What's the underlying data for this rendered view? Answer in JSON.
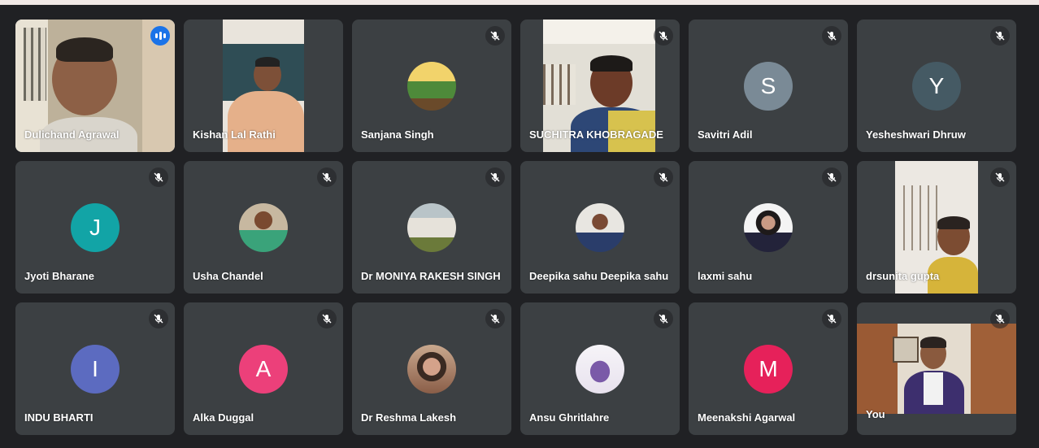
{
  "participants": [
    {
      "name": "Dulichand Agrawal",
      "type": "video",
      "speaking": true
    },
    {
      "name": "Kishan Lal Rathi",
      "type": "video"
    },
    {
      "name": "Sanjana Singh",
      "type": "photo",
      "muted": true
    },
    {
      "name": "SUCHITRA KHOBRAGADE",
      "type": "video",
      "muted": true
    },
    {
      "name": "Savitri Adil",
      "type": "initial",
      "initial": "S",
      "color": "#7a8a96",
      "muted": true
    },
    {
      "name": "Yesheshwari Dhruw",
      "type": "initial",
      "initial": "Y",
      "color": "#455a64",
      "muted": true
    },
    {
      "name": "Jyoti Bharane",
      "type": "initial",
      "initial": "J",
      "color": "#12a4a6",
      "muted": true
    },
    {
      "name": "Usha Chandel",
      "type": "photo",
      "muted": true
    },
    {
      "name": "Dr MONIYA RAKESH SINGH",
      "type": "photo",
      "muted": true
    },
    {
      "name": "Deepika sahu Deepika sahu",
      "type": "photo",
      "muted": true
    },
    {
      "name": "laxmi sahu",
      "type": "photo",
      "muted": true
    },
    {
      "name": "drsunita gupta",
      "type": "video",
      "muted": true
    },
    {
      "name": "INDU BHARTI",
      "type": "initial",
      "initial": "I",
      "color": "#5c6bc0",
      "muted": true
    },
    {
      "name": "Alka Duggal",
      "type": "initial",
      "initial": "A",
      "color": "#ec407a",
      "muted": true
    },
    {
      "name": "Dr Reshma Lakesh",
      "type": "photo",
      "muted": true
    },
    {
      "name": "Ansu Ghritlahre",
      "type": "photo",
      "muted": true
    },
    {
      "name": "Meenakshi Agarwal",
      "type": "initial",
      "initial": "M",
      "color": "#e6215a",
      "muted": true
    },
    {
      "name": "You",
      "type": "video",
      "muted": true
    }
  ],
  "icons": {
    "mute": "mic-off-icon",
    "speaking": "audio-level-icon"
  },
  "colors": {
    "tile_bg": "#3c4043",
    "page_bg": "#202124",
    "active_border": "#8ab4f8"
  }
}
